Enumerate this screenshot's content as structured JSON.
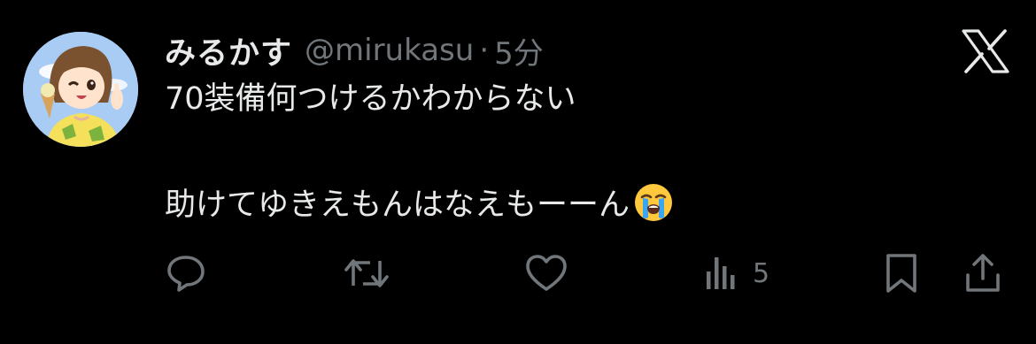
{
  "tweet": {
    "display_name": "みるかす",
    "handle": "@mirukasu",
    "separator": "·",
    "time": "5分",
    "text_line_1": "70装備何つけるかわからない",
    "text_line_2": "助けてゆきえもんはなえもーーん",
    "emoji": "loudly-crying-face"
  },
  "actions": {
    "reply_icon": "reply-icon",
    "retweet_icon": "retweet-icon",
    "like_icon": "heart-icon",
    "views_icon": "views-chart-icon",
    "views_count": "5",
    "bookmark_icon": "bookmark-icon",
    "share_icon": "share-icon"
  },
  "colors": {
    "background": "#000000",
    "primary_text": "#e7e9ea",
    "secondary_text": "#71767b"
  }
}
